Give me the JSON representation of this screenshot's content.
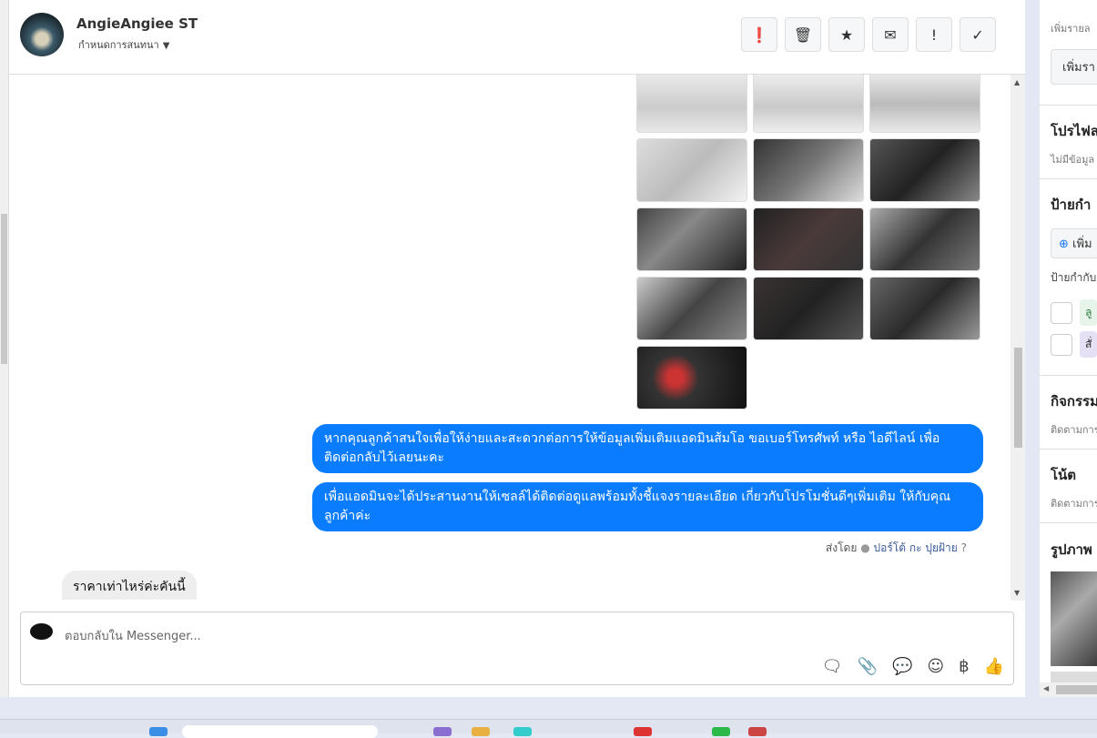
{
  "header": {
    "name": "AngieAngiee ST",
    "subtitle": "กำหนดการสนทนา"
  },
  "actions": [
    {
      "icon": "alert-circle-icon",
      "glyph": "❗"
    },
    {
      "icon": "trash-icon",
      "glyph": "🗑"
    },
    {
      "icon": "star-icon",
      "glyph": "★"
    },
    {
      "icon": "envelope-icon",
      "glyph": "✉"
    },
    {
      "icon": "exclamation-icon",
      "glyph": "!"
    },
    {
      "icon": "check-icon",
      "glyph": "✓"
    }
  ],
  "messages": {
    "out1": "หากคุณลูกค้าสนใจเพื่อให้ง่ายและสะดวกต่อการให้ข้อมูลเพิ่มเติมแอดมินส้มโอ ขอเบอร์โทรศัพท์ หรือ ไอดีไลน์ เพื่อติดต่อกลับไว้เลยนะคะ",
    "out2": "เพื่อแอดมินจะได้ประสานงานให้เซลล์ได้ติดต่อดูแลพร้อมทั้งชี้แจงรายละเอียด เกี่ยวกับโปรโมชั่นดีๆเพิ่มเติม ให้กับคุณลูกค้าค่ะ",
    "sent_by_label": "ส่งโดย",
    "sent_by_name": "ปอร์โต้ กะ ปุยฝ้าย",
    "in1": "ราคาเท่าไหร่ค่ะคันนี้"
  },
  "composer": {
    "placeholder": "ตอบกลับใน Messenger..."
  },
  "right": {
    "s1_sub": "เพิ่มรายล",
    "s1_btn": "เพิ่มรา",
    "profile": "โปรไฟล",
    "profile_sub": "ไม่มีข้อมูล",
    "labels": "ป้ายกำ",
    "labels_add": "เพิ่ม",
    "labels_sub": "ป้ายกำกับ",
    "tag1": "ลู",
    "tag2": "สั่",
    "activity": "กิจกรรม",
    "activity_sub": "ติดตามการ",
    "notes": "โน้ต",
    "notes_sub": "ติดตามการ",
    "photos": "รูปภาพ"
  },
  "colors": {
    "accent": "#0a7cff"
  }
}
